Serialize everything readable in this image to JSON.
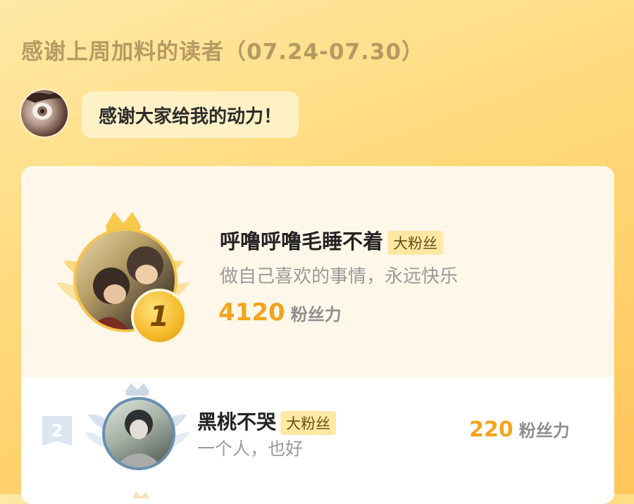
{
  "header": {
    "title": "感谢上周加料的读者（07.24-07.30）"
  },
  "author_message": {
    "avatar_icon": "author-avatar-image",
    "text": "感谢大家给我的动力！"
  },
  "leaderboard": [
    {
      "rank": "1",
      "name": "呼噜呼噜毛睡不着",
      "tag": "大粉丝",
      "motto": "做自己喜欢的事情，永远快乐",
      "score": "4120",
      "unit": "粉丝力"
    },
    {
      "rank": "2",
      "name": "黑桃不哭",
      "tag": "大粉丝",
      "motto": "一个人，也好",
      "score": "220",
      "unit": "粉丝力"
    }
  ],
  "colors": {
    "accent": "#f3a41b",
    "gold_medal": "#f5c64f",
    "silver_medal": "#c9d8e8"
  }
}
